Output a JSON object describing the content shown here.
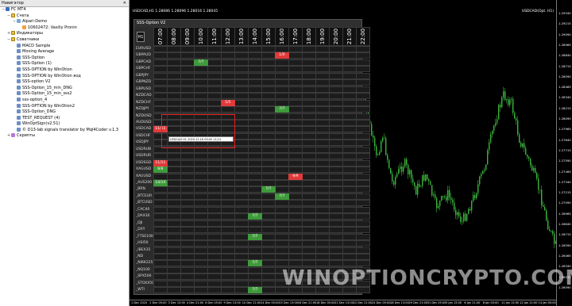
{
  "navigator": {
    "title": "Навигатор",
    "items": [
      {
        "label": "FC MT4",
        "icon": "root-icon",
        "level": 0,
        "toggle": "−"
      },
      {
        "label": "Счета",
        "icon": "folder-icon",
        "level": 1,
        "toggle": "−"
      },
      {
        "label": "Alpari-Demo",
        "icon": "account-icon",
        "level": 2,
        "toggle": "−"
      },
      {
        "label": "10602472: Vasiliy Pronin",
        "icon": "user-icon",
        "level": 3,
        "toggle": ""
      },
      {
        "label": "Индикаторы",
        "icon": "folder-icon",
        "level": 1,
        "toggle": "+"
      },
      {
        "label": "Советники",
        "icon": "folder-icon",
        "level": 1,
        "toggle": "−"
      },
      {
        "label": "MACD Sample",
        "icon": "expert-icon",
        "level": 2,
        "toggle": ""
      },
      {
        "label": "Moving Average",
        "icon": "expert-icon",
        "level": 2,
        "toggle": ""
      },
      {
        "label": "SSS-Option",
        "icon": "expert-icon",
        "level": 2,
        "toggle": ""
      },
      {
        "label": "SSS-Option (1)",
        "icon": "expert-icon",
        "level": 2,
        "toggle": ""
      },
      {
        "label": "SSS-OPTION by WinOtion",
        "icon": "expert-icon",
        "level": 2,
        "toggle": ""
      },
      {
        "label": "SSS-OPTION by WinOtion вод",
        "icon": "expert-icon",
        "level": 2,
        "toggle": ""
      },
      {
        "label": "SSS-option V2",
        "icon": "expert-icon",
        "level": 2,
        "toggle": ""
      },
      {
        "label": "SSS-Option_15_min_DNG",
        "icon": "expert-icon",
        "level": 2,
        "toggle": ""
      },
      {
        "label": "SSS-Option_15_min_sss2",
        "icon": "expert-icon",
        "level": 2,
        "toggle": ""
      },
      {
        "label": "sss-option_4",
        "icon": "expert-icon",
        "level": 2,
        "toggle": ""
      },
      {
        "label": "SSS-OPTION by WinOtion2",
        "icon": "expert-icon",
        "level": 2,
        "toggle": ""
      },
      {
        "label": "SSS-Option_DNG",
        "icon": "expert-icon",
        "level": 2,
        "toggle": ""
      },
      {
        "label": "TEST_REQUEST (4)",
        "icon": "expert-icon",
        "level": 2,
        "toggle": ""
      },
      {
        "label": "WinOptSign(v2.51)",
        "icon": "expert-icon",
        "level": 2,
        "toggle": ""
      },
      {
        "label": "© D13-lab signals translator by Mql4Coder v.1.3",
        "icon": "expert-icon",
        "level": 2,
        "toggle": ""
      },
      {
        "label": "Скрипты",
        "icon": "script-icon",
        "level": 1,
        "toggle": "+"
      }
    ]
  },
  "chart": {
    "title": "USDCAD,H1  1.28086  1.28096  1.28016  1.28045",
    "timeframe_label": "USDCAD(Opt. H1)",
    "price_ticks": [
      "1.29340",
      "1.29215",
      "1.29090",
      "1.28965",
      "1.28840",
      "1.28715",
      "1.28590",
      "1.28465",
      "1.28340",
      "1.28215",
      "1.28090",
      "1.27965",
      "1.27840",
      "1.27715",
      "1.27590",
      "1.27465",
      "1.27340",
      "1.27215",
      "1.27090",
      "1.26965",
      "1.26840",
      "1.26715",
      "1.26590",
      "1.26465",
      "1.26340",
      "1.26215",
      "1.26090"
    ],
    "time_ticks": [
      "1 Dec 2020",
      "2 Dec 05:00",
      "3 Dec 13:00",
      "4 Dec 21:00",
      "8 Dec 05:00",
      "9 Dec 13:00",
      "10 Dec 21:00",
      "14 Dec 05:00",
      "15 Dec 13:00",
      "16 Dec 21:00",
      "18 Dec 05:00",
      "21 Dec 13:00",
      "22 Dec 21:00",
      "24 Dec 05:00",
      "28 Dec 13:00",
      "29 Dec 21:00",
      "31 Dec 05:00",
      "5 Jan 13:00",
      "6 Jan 21:00",
      "8 Jan 05:00",
      "11 Jan 13:00",
      "12 Jan 21:00",
      "14 Jan 05:00"
    ],
    "watermark": "WINOPTIONCRYPTO.COM",
    "candle_color": "#3cb43c"
  },
  "dashboard": {
    "title": "SSS-Option V2",
    "tf_button": "H1",
    "hours": [
      "07:00",
      "08:00",
      "09:00",
      "10:00",
      "11:00",
      "12:00",
      "13:00",
      "14:00",
      "15:00",
      "16:00",
      "17:00",
      "18:00",
      "19:00",
      "20:00",
      "21:00",
      "22:00"
    ],
    "symbols": [
      "EURUSD",
      "GBPAUD",
      "GBPCAD",
      "GBPCHF",
      "GBPJPY",
      "GBPNZD",
      "GBPUSD",
      "NZDCAD",
      "NZDCHF",
      "NZDJPY",
      "NZDUSD",
      "AUDUSD",
      "USDCAD",
      "USDCHF",
      "USDJPY",
      "USDRUB",
      "USDRUR",
      "USDSGD",
      "XAGUSD",
      "XAUUSD",
      "_AUS200",
      "_BRN",
      "_BTCEUR",
      "_BTCUSD",
      "_CAC40",
      "_DAX30",
      "_DJI",
      "_DXY",
      "_FTSE100",
      "_HSI50",
      "_IBEX35",
      "_ND",
      "_NIKK225",
      "_NQ100",
      "_SPX500",
      "_STOXX50",
      "_WTI"
    ],
    "signals": [
      {
        "row": 1,
        "col": 9,
        "text": "1/0",
        "dir": "down"
      },
      {
        "row": 2,
        "col": 3,
        "text": "7/7",
        "dir": "up"
      },
      {
        "row": 8,
        "col": 5,
        "text": "5/5",
        "dir": "down"
      },
      {
        "row": 9,
        "col": 9,
        "text": "7/7",
        "dir": "up"
      },
      {
        "row": 12,
        "col": 0,
        "text": "11/11",
        "dir": "down"
      },
      {
        "row": 17,
        "col": 0,
        "text": "11/11",
        "dir": "down"
      },
      {
        "row": 18,
        "col": 0,
        "text": "8/8",
        "dir": "up"
      },
      {
        "row": 19,
        "col": 10,
        "text": "9/9",
        "dir": "down"
      },
      {
        "row": 20,
        "col": 0,
        "text": "14/14",
        "dir": "up"
      },
      {
        "row": 21,
        "col": 8,
        "text": "7/7",
        "dir": "up"
      },
      {
        "row": 22,
        "col": 9,
        "text": "7/7",
        "dir": "up"
      },
      {
        "row": 25,
        "col": 7,
        "text": "7/7",
        "dir": "up"
      },
      {
        "row": 28,
        "col": 7,
        "text": "7/7",
        "dir": "up"
      },
      {
        "row": 32,
        "col": 7,
        "text": "7/7",
        "dir": "up"
      },
      {
        "row": 36,
        "col": 7,
        "text": "7/7",
        "dir": "up"
      }
    ],
    "tooltip": "USDCAD H1 2020.12.16 09:00 11/11",
    "highlight_color": "#e02020"
  }
}
